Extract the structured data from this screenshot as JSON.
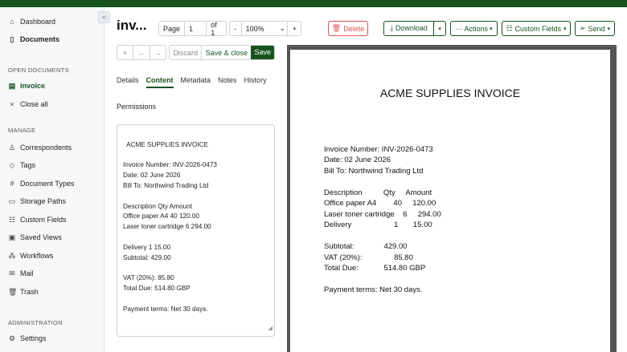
{
  "sidebar": {
    "collapse_icon": "«",
    "dashboard": "Dashboard",
    "documents": "Documents",
    "open_documents_heading": "OPEN DOCUMENTS",
    "open_doc": "invoice",
    "close_all": "Close all",
    "manage_heading": "MANAGE",
    "correspondents": "Correspondents",
    "tags": "Tags",
    "document_types": "Document Types",
    "storage_paths": "Storage Paths",
    "custom_fields": "Custom Fields",
    "saved_views": "Saved Views",
    "workflows": "Workflows",
    "mail": "Mail",
    "trash": "Trash",
    "admin_heading": "ADMINISTRATION",
    "settings": "Settings"
  },
  "toolbar": {
    "title": "inv...",
    "page_label": "Page",
    "page_value": "1",
    "page_of": "of 1",
    "zoom_minus": "-",
    "zoom_value": "100%",
    "zoom_plus": "+",
    "delete": "Delete",
    "download": "Download",
    "actions": "··· Actions",
    "custom_fields": "Custom Fields",
    "send": "Send",
    "discard": "Discard",
    "save_close": "Save & close",
    "save": "Save"
  },
  "tabs": [
    "Details",
    "Content",
    "Metadata",
    "Notes",
    "History"
  ],
  "permissions": "Permissions",
  "content_text": "ACME SUPPLIES INVOICE\n\nInvoice Number: INV-2026-0473\nDate: 02 June 2026\nBill To: Northwind Trading Ltd\n\nDescription Qty Amount\nOffice paper A4 40 120.00\nLaser toner cartridge 6 294.00\n\nDelivery 1 15.00\nSubtotal: 429.00\n\nVAT (20%): 85.80\nTotal Due: 514.80 GBP\n\nPayment terms: Net 30 days.",
  "preview": {
    "title": "ACME SUPPLIES INVOICE",
    "invoice_number": "Invoice Number: INV-2026-0473",
    "date": "Date: 02 June 2026",
    "bill_to": "Bill To: Northwind Trading Ltd",
    "table_header": "Description          Qty     Amount",
    "row1": "Office paper A4        40     120.00",
    "row2": "Laser toner cartridge    6     294.00",
    "row3": "Delivery                    1       15.00",
    "subtotal": "Subtotal:              429.00",
    "vat": "VAT (20%):               85.80",
    "total": "Total Due:            514.80 GBP",
    "terms": "Payment terms: Net 30 days."
  }
}
